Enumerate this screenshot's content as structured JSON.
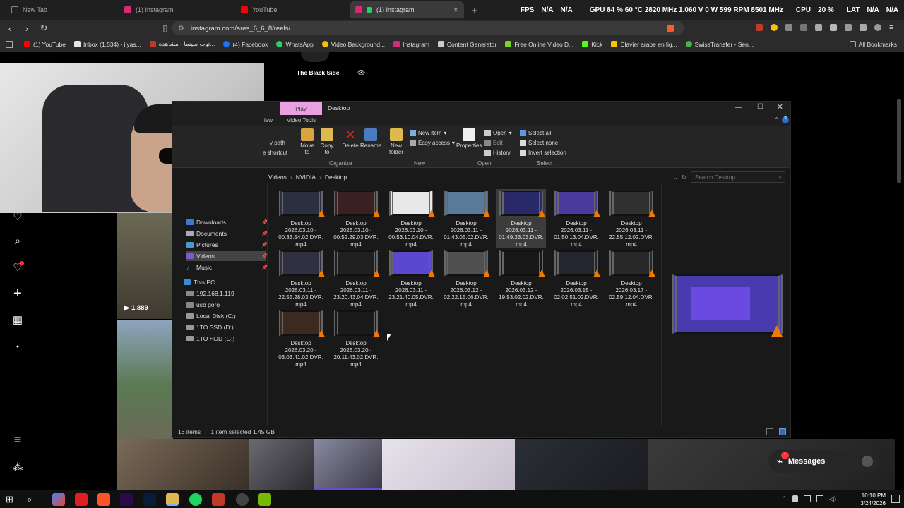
{
  "browser": {
    "tabs": [
      {
        "label": "New Tab",
        "active": false
      },
      {
        "label": "(1) Instagram",
        "active": false
      },
      {
        "label": "YouTube",
        "active": false
      },
      {
        "label": "(1) Instagram",
        "active": true
      }
    ],
    "new_tab_glyph": "+",
    "url": "instagram.com/ares_6_6_8/reels/",
    "bookmarks": [
      {
        "label": "(1) YouTube",
        "color": "#ff0000"
      },
      {
        "label": "Inbox (1,534) - ilyas...",
        "color": "#e5e5e5"
      },
      {
        "label": "توب سينما - مشاهدة...",
        "color": "#c0392b"
      },
      {
        "label": "(4) Facebook",
        "color": "#1877f2"
      },
      {
        "label": "WhatsApp",
        "color": "#25d366"
      },
      {
        "label": "Video Background...",
        "color": "#f5c400"
      },
      {
        "label": "Instagram",
        "color": "#d62976"
      },
      {
        "label": "Content Generator",
        "color": "#cccccc"
      },
      {
        "label": "Free Online Video D...",
        "color": "#7ed321"
      },
      {
        "label": "Kick",
        "color": "#53fc18"
      },
      {
        "label": "Clavier arabe en lig...",
        "color": "#f5c400"
      },
      {
        "label": "SwissTransfer - Sen...",
        "color": "#4caf50"
      }
    ],
    "all_bookmarks": "All Bookmarks"
  },
  "overlay": {
    "fps_label": "FPS",
    "fps_value1": "N/A",
    "fps_value2": "N/A",
    "gpu": "GPU 84 % 60 °C 2820 MHz 1.060 V 0 W 599 RPM 8501 MHz",
    "cpu_label": "CPU",
    "cpu_value": "20 %",
    "lat_label": "LAT",
    "lat_value1": "N/A",
    "lat_value2": "N/A"
  },
  "instagram": {
    "profile_name": "The Black Side",
    "reel_views": "1,889",
    "messages_label": "Messages",
    "messages_badge": "1"
  },
  "explorer": {
    "context_tab": "Play",
    "title": "Desktop",
    "ribbon_tabs": [
      "iew",
      "Video Tools"
    ],
    "ribbon": {
      "path_frag1": "y path",
      "path_frag2": "e shortcut",
      "move_to": "Move to",
      "copy_to": "Copy to",
      "delete": "Delete",
      "rename": "Rename",
      "new_folder": "New folder",
      "new_item": "New item",
      "easy_access": "Easy access",
      "properties": "Properties",
      "open": "Open",
      "edit": "Edit",
      "history": "History",
      "select_all": "Select all",
      "select_none": "Select none",
      "invert_selection": "Invert selection",
      "groups": [
        "Organize",
        "New",
        "Open",
        "Select"
      ]
    },
    "breadcrumb": [
      "Videos",
      "NVIDIA",
      "Desktop"
    ],
    "search_placeholder": "Search Desktop",
    "nav_quick": [
      {
        "label": "Downloads",
        "pinned": true
      },
      {
        "label": "Documents",
        "pinned": true
      },
      {
        "label": "Pictures",
        "pinned": true
      },
      {
        "label": "Videos",
        "pinned": true,
        "selected": true
      },
      {
        "label": "Music",
        "pinned": true
      }
    ],
    "nav_pc": "This PC",
    "nav_drives": [
      "192.168.1.119",
      "usb goro",
      "Local Disk (C:)",
      "1TO SSD (D:)",
      "1TO HDD (G:)"
    ],
    "files": [
      {
        "name": "Desktop 2026.03.10 - 00.33.54.02.DVR. mp4",
        "thumb": "#2a3040"
      },
      {
        "name": "Desktop 2026.03.10 - 00.52.29.03.DVR. mp4",
        "thumb": "#3a2020"
      },
      {
        "name": "Desktop 2026.03.10 - 00.53.10.04.DVR. mp4",
        "thumb": "#e8e8e8"
      },
      {
        "name": "Desktop 2026.03.11 - 01.43.05.02.DVR. mp4",
        "thumb": "#5a7a9a"
      },
      {
        "name": "Desktop 2026.03.11 - 01.49.33.03.DVR. mp4",
        "thumb": "#2a2a6a",
        "selected": true
      },
      {
        "name": "Desktop 2026.03.11 - 01.50.13.04.DVR. mp4",
        "thumb": "#4a3aa0"
      },
      {
        "name": "Desktop 2026.03.11 - 22.55.12.02.DVR. mp4",
        "thumb": "#303030"
      },
      {
        "name": "Desktop 2026.03.11 - 22.55.28.03.DVR. mp4",
        "thumb": "#303040"
      },
      {
        "name": "Desktop 2026.03.11 - 23.20.43.04.DVR. mp4",
        "thumb": "#202020"
      },
      {
        "name": "Desktop 2026.03.11 - 23.21.40.05.DVR. mp4",
        "thumb": "#5a48d0"
      },
      {
        "name": "Desktop 2026.03.12 - 02.22.15.06.DVR. mp4",
        "thumb": "#505050"
      },
      {
        "name": "Desktop 2026.03.12 - 19.53.02.02.DVR. mp4",
        "thumb": "#181818"
      },
      {
        "name": "Desktop 2026.03.15 - 02.02.51.02.DVR. mp4",
        "thumb": "#252530"
      },
      {
        "name": "Desktop 2026.03.17 - 02.59.12.04.DVR. mp4",
        "thumb": "#282828"
      },
      {
        "name": "Desktop 2026.03.20 - 03.03.41.02.DVR. mp4",
        "thumb": "#3a2a20"
      },
      {
        "name": "Desktop 2026.03.20 - 20.11.43.02.DVR. mp4",
        "thumb": "#1a1a1a"
      }
    ],
    "status_count": "16 items",
    "status_selected": "1 item selected  1.45 GB"
  },
  "taskbar": {
    "time": "10:10 PM",
    "date": "3/24/2026"
  }
}
